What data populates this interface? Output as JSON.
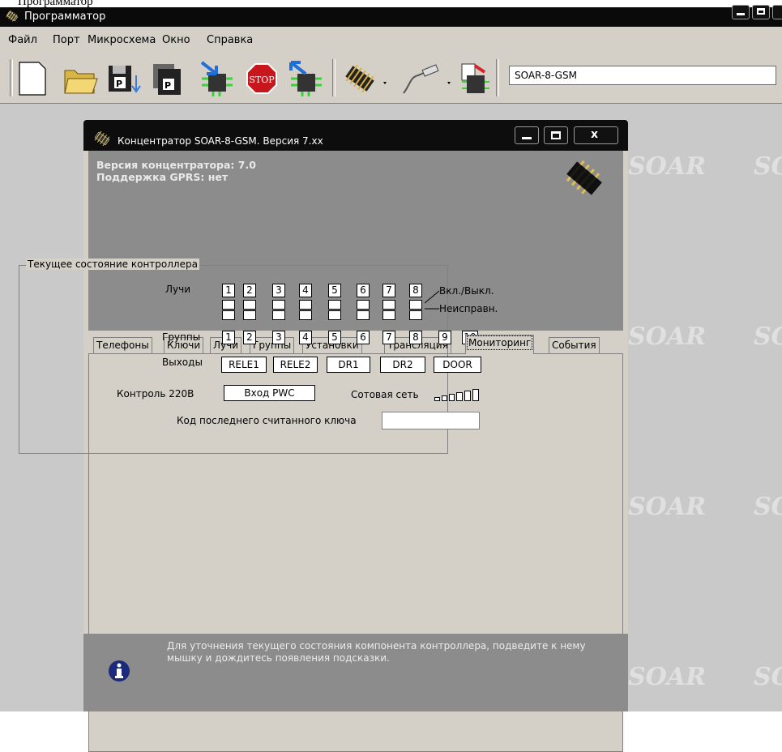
{
  "outer_caption": "Программатор",
  "main_window": {
    "title": "Программатор"
  },
  "menu": [
    "Файл",
    "Порт",
    "Микросхема",
    "Окно",
    "Справка"
  ],
  "toolbar": {
    "stop_label": "STOP",
    "device_value": "SOAR-8-GSM"
  },
  "watermark": "SOAR",
  "child_window": {
    "title": "Концентратор SOAR-8-GSM. Версия 7.xx",
    "version_line": "Версия концентратора: 7.0",
    "gprs_line": "Поддержка GPRS: нет",
    "tabs": [
      "Телефоны",
      "Ключи",
      "Лучи",
      "Группы",
      "Установки",
      "Трансляция",
      "Мониторинг",
      "События"
    ],
    "active_tab": "Мониторинг",
    "monitor": {
      "group_title": "Текущее состояние контроллера",
      "beams_label": "Лучи",
      "beams": [
        "1",
        "2",
        "3",
        "4",
        "5",
        "6",
        "7",
        "8"
      ],
      "legend_on_off": "Вкл./Выкл.",
      "legend_fault": "Неисправн.",
      "groups_label": "Группы",
      "groups": [
        "1",
        "2",
        "3",
        "4",
        "5",
        "6",
        "7",
        "8",
        "9",
        "10"
      ],
      "outputs_label": "Выходы",
      "outputs": [
        "RELE1",
        "RELE2",
        "DR1",
        "DR2",
        "DOOR"
      ],
      "power_label": "Контроль 220В",
      "pwc_value": "Вход PWC",
      "cell_label": "Сотовая сеть",
      "last_key_label": "Код последнего считанного ключа",
      "last_key_value": ""
    },
    "hint": "Для уточнения текущего состояния компонента контроллера, подведите к нему мышку и дождитесь появления подсказки."
  }
}
